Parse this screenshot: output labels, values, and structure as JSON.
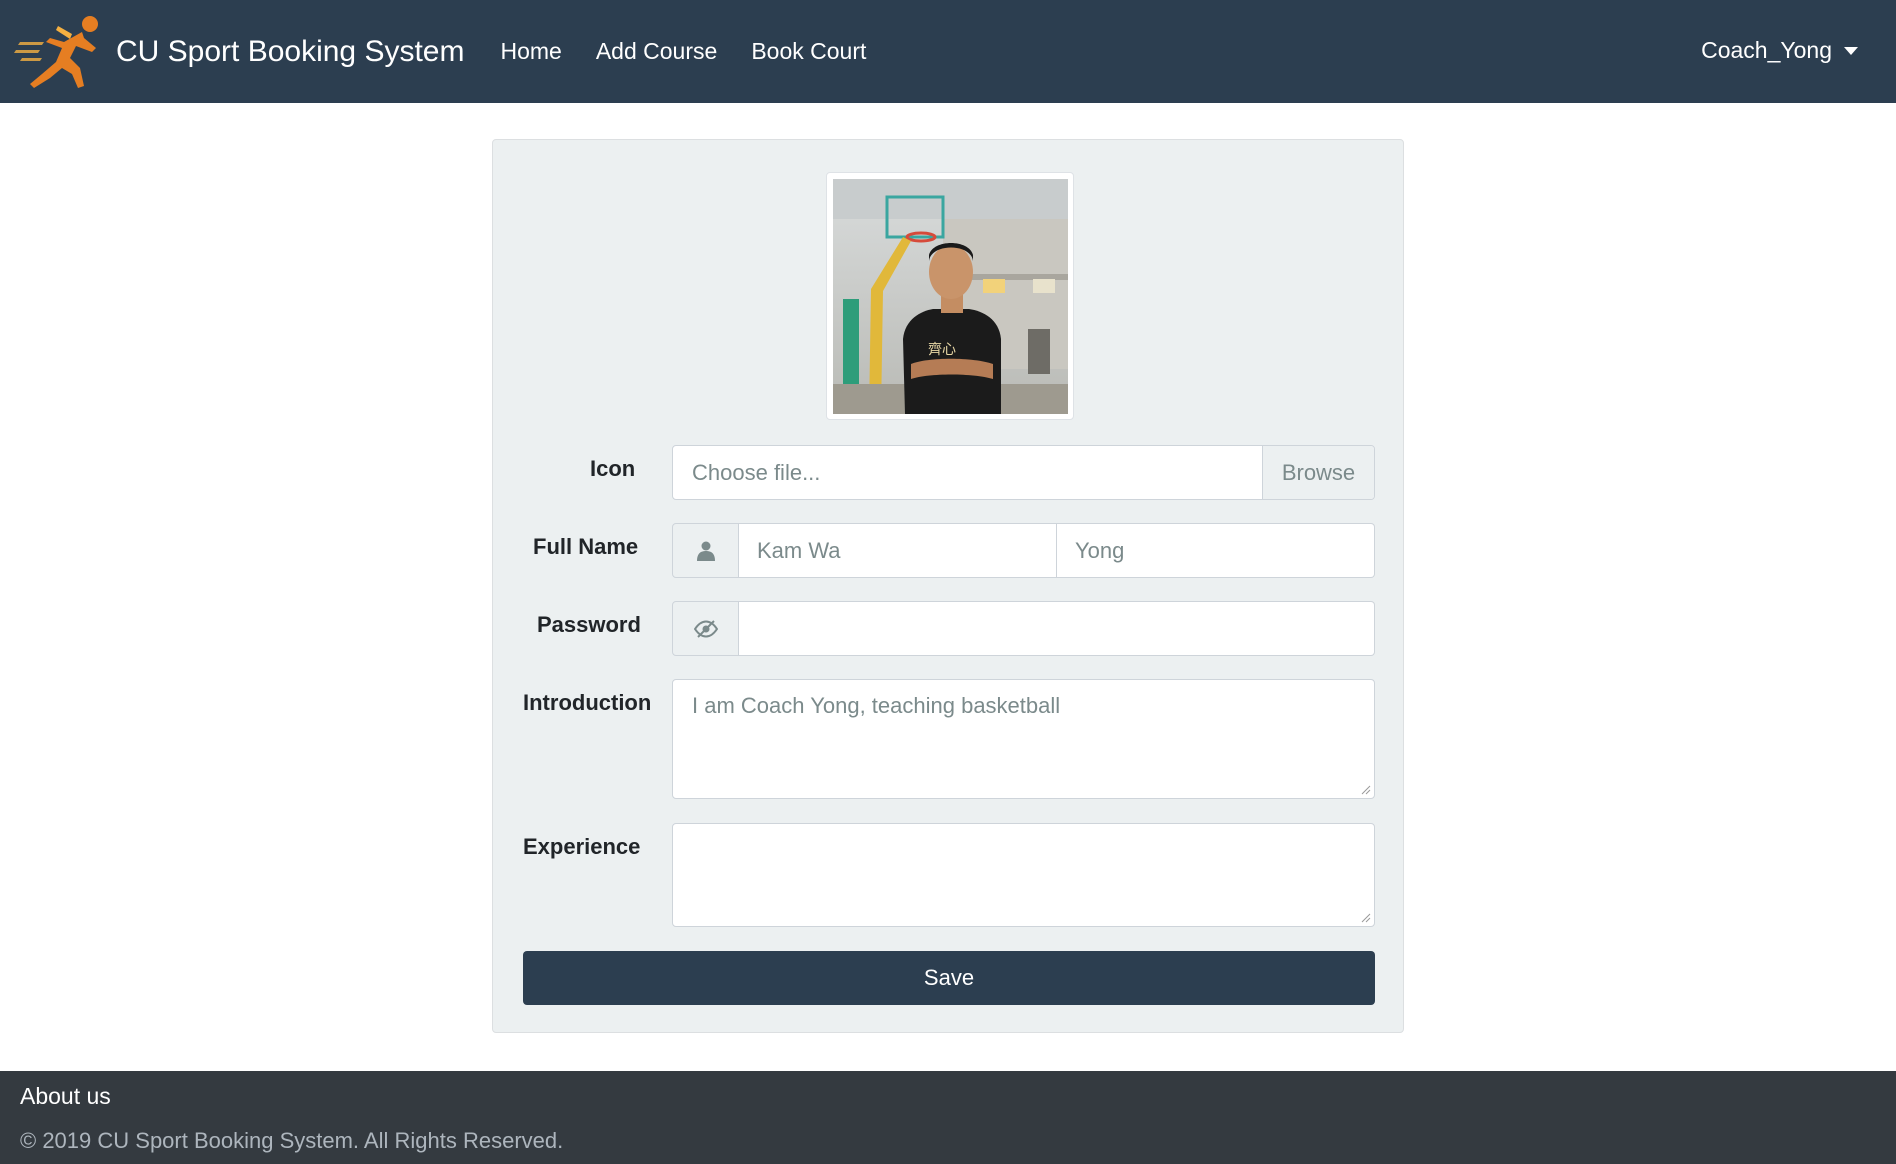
{
  "navbar": {
    "brand": "CU Sport Booking System",
    "links": [
      "Home",
      "Add Course",
      "Book Court"
    ],
    "user": "Coach_Yong",
    "logo_icon": "sprinter-logo",
    "bg_color": "#2c3e50"
  },
  "profile_form": {
    "avatar_alt": "profile-photo",
    "icon": {
      "label": "Icon",
      "placeholder": "Choose file...",
      "browse_label": "Browse"
    },
    "full_name": {
      "label": "Full Name",
      "icon": "user-icon",
      "first_name": "Kam Wa",
      "last_name": "Yong"
    },
    "password": {
      "label": "Password",
      "icon": "eye-slash-icon",
      "value": ""
    },
    "introduction": {
      "label": "Introduction",
      "value": "I am Coach Yong, teaching basketball"
    },
    "experience": {
      "label": "Experience",
      "value": ""
    },
    "save_label": "Save"
  },
  "footer": {
    "title": "About us",
    "copyright": "© 2019 CU Sport Booking System. All Rights Reserved."
  }
}
